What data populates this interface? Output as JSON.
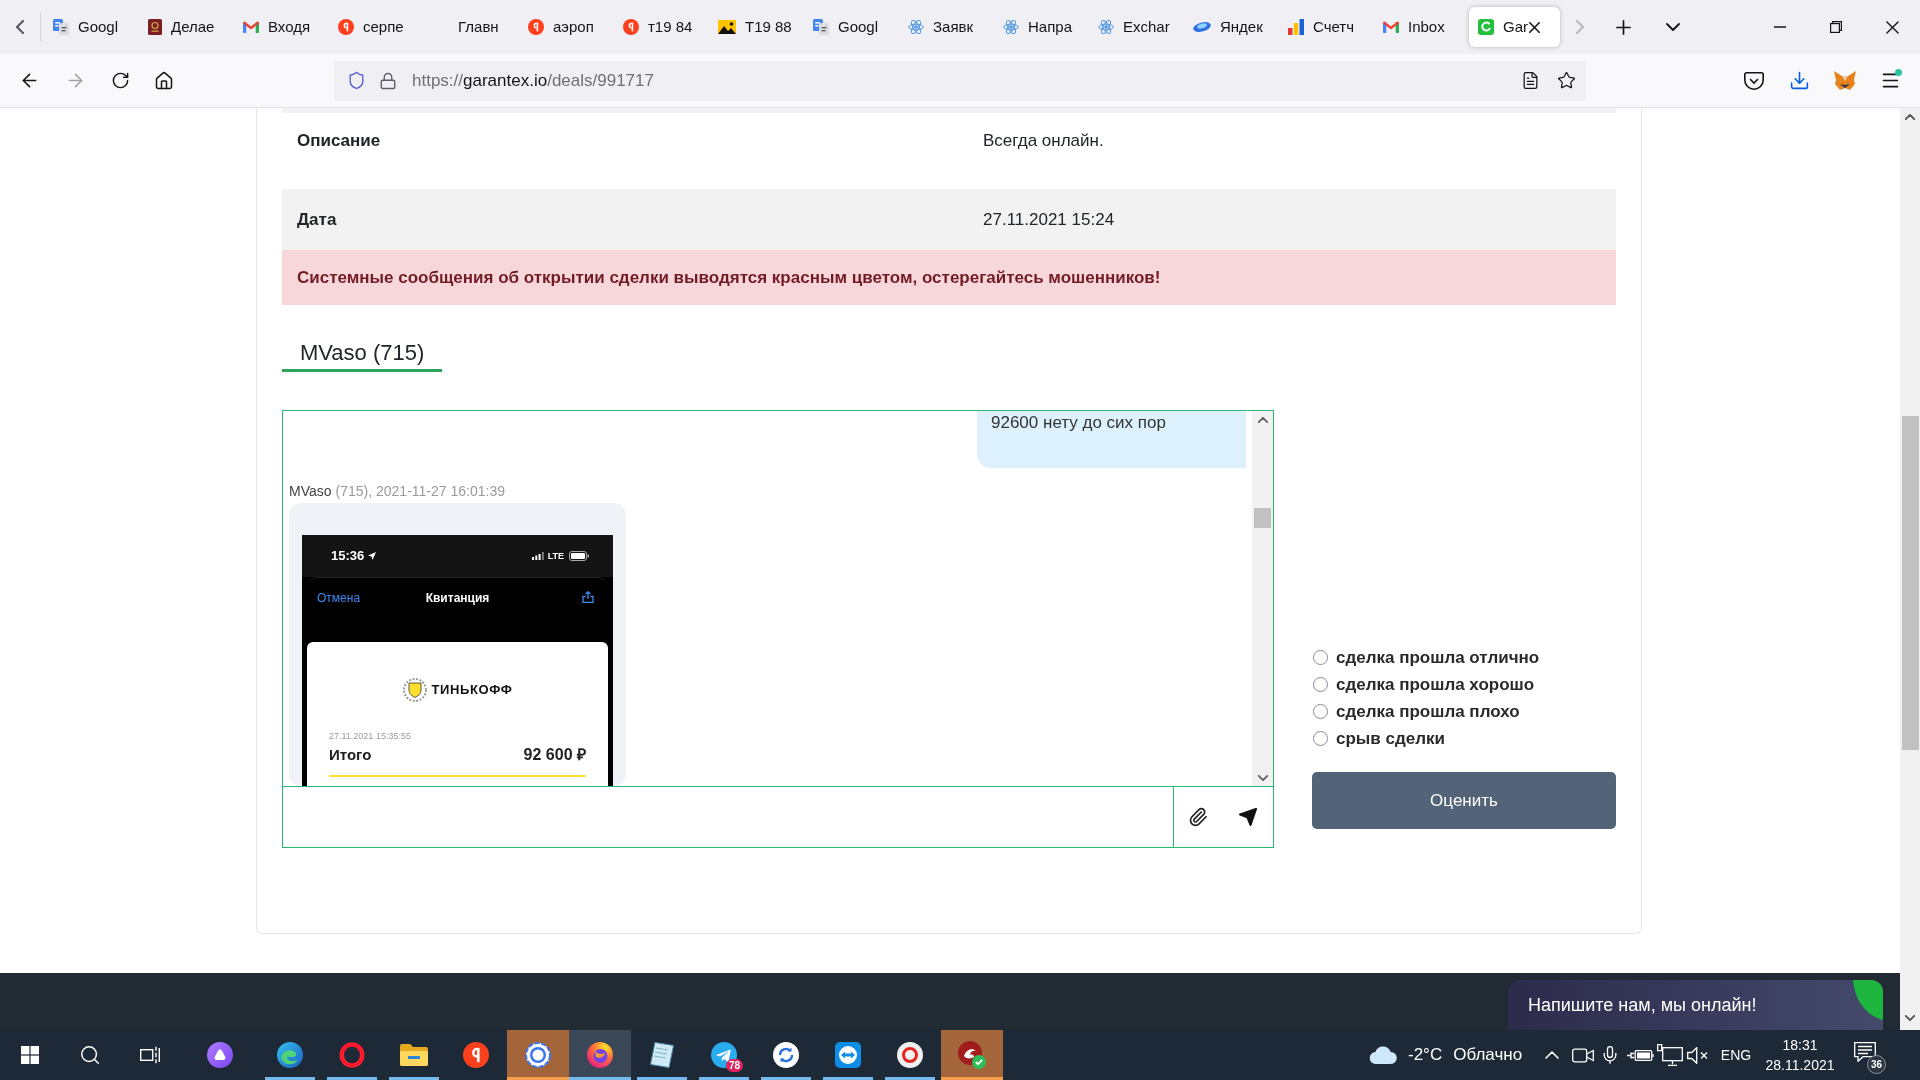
{
  "browser": {
    "tabs": [
      {
        "label": "Googl",
        "selected": false
      },
      {
        "label": "Делае",
        "selected": false
      },
      {
        "label": "Входя",
        "selected": false
      },
      {
        "label": "серпе",
        "selected": false
      },
      {
        "label": "Главн",
        "selected": false
      },
      {
        "label": "аэроп",
        "selected": false
      },
      {
        "label": "т19 84",
        "selected": false
      },
      {
        "label": "Т19 88",
        "selected": false
      },
      {
        "label": "Googl",
        "selected": false
      },
      {
        "label": "Заявк",
        "selected": false
      },
      {
        "label": "Напра",
        "selected": false
      },
      {
        "label": "Exchar",
        "selected": false
      },
      {
        "label": "Яндек",
        "selected": false
      },
      {
        "label": "Счетч",
        "selected": false
      },
      {
        "label": "Inbox",
        "selected": false
      },
      {
        "label": "Gar",
        "selected": true
      }
    ],
    "url": {
      "scheme": "https://",
      "host": "garantex.io",
      "path": "/deals/991717"
    }
  },
  "deal": {
    "rows": [
      {
        "label": "Описание",
        "value": "Всегда онлайн."
      },
      {
        "label": "Дата",
        "value": "27.11.2021 15:24"
      }
    ],
    "alert": "Системные сообщения об открытии сделки выводятся красным цветом, остерегайтесь мошенников!"
  },
  "chat": {
    "tabs": [
      {
        "label": "MVaso (715)",
        "selected": true
      }
    ],
    "messages": [
      {
        "kind": "outgoing",
        "text": "92600 нету до сих пор"
      },
      {
        "kind": "incoming",
        "author": "MVaso",
        "meta": "(715), 2021-11-27 16:01:39",
        "screenshot": {
          "time": "15:36",
          "network": "LTE",
          "cancel": "Отмена",
          "title": "Квитанция",
          "bank": "ТИНЬКОФФ",
          "datetime": "27.11.2021 15:35:55",
          "total_label": "Итого",
          "total": "92 600 ₽"
        }
      }
    ]
  },
  "rating": {
    "options": [
      {
        "label": "сделка прошла отлично",
        "selected": false
      },
      {
        "label": "сделка прошла хорошо",
        "selected": false
      },
      {
        "label": "сделка прошла плохо",
        "selected": false
      },
      {
        "label": "срыв сделки",
        "selected": false
      }
    ],
    "button": "Оценить"
  },
  "chat_widget": {
    "text": "Напишите нам, мы онлайн!"
  },
  "taskbar": {
    "apps": [
      {
        "running": true,
        "selected": false,
        "flashing": false
      },
      {
        "running": true,
        "selected": false,
        "flashing": false
      },
      {
        "running": true,
        "selected": false,
        "flashing": false
      },
      {
        "running": false,
        "selected": false,
        "flashing": false
      },
      {
        "running": true,
        "selected": false,
        "flashing": true
      },
      {
        "running": true,
        "selected": true,
        "flashing": false
      },
      {
        "running": true,
        "selected": false,
        "flashing": false
      },
      {
        "running": true,
        "selected": false,
        "flashing": false,
        "badge": "78"
      },
      {
        "running": true,
        "selected": false,
        "flashing": false
      },
      {
        "running": true,
        "selected": false,
        "flashing": false
      },
      {
        "running": true,
        "selected": false,
        "flashing": false
      },
      {
        "running": true,
        "selected": false,
        "flashing": true
      }
    ],
    "tray": {
      "temperature": "-2°C",
      "weather": "Облачно",
      "language": "ENG",
      "time": "18:31",
      "date": "28.11.2021",
      "notifications": "36"
    }
  }
}
